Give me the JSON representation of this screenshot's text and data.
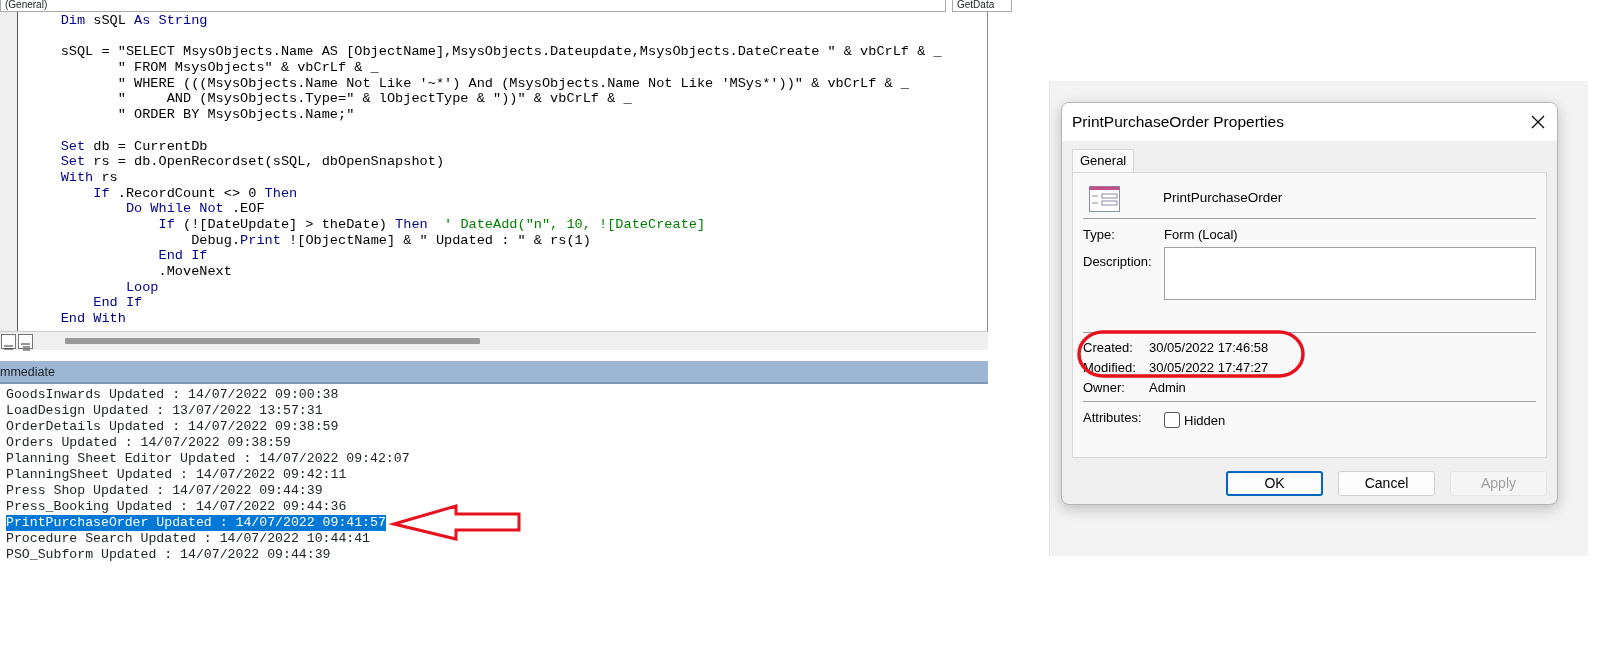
{
  "editor": {
    "object_combo": "(General)",
    "procedure_combo": "GetData",
    "code_lines": [
      {
        "kind": "code",
        "tokens": [
          {
            "kind": "keyword",
            "text": "    Dim"
          },
          {
            "kind": "plain",
            "text": " sSQL "
          },
          {
            "kind": "keyword",
            "text": "As String"
          }
        ]
      },
      {
        "kind": "blank"
      },
      {
        "kind": "code",
        "tokens": [
          {
            "kind": "plain",
            "text": "    sSQL = \"SELECT MsysObjects.Name AS [ObjectName],MsysObjects.Dateupdate,MsysObjects.DateCreate \" & vbCrLf & _"
          }
        ]
      },
      {
        "kind": "code",
        "tokens": [
          {
            "kind": "plain",
            "text": "           \" FROM MsysObjects\" & vbCrLf & _"
          }
        ]
      },
      {
        "kind": "code",
        "tokens": [
          {
            "kind": "plain",
            "text": "           \" WHERE (((MsysObjects.Name Not Like '~*') And (MsysObjects.Name Not Like 'MSys*'))\" & vbCrLf & _"
          }
        ]
      },
      {
        "kind": "code",
        "tokens": [
          {
            "kind": "plain",
            "text": "           \"     AND (MsysObjects.Type=\" & lObjectType & \"))\" & vbCrLf & _"
          }
        ]
      },
      {
        "kind": "code",
        "tokens": [
          {
            "kind": "plain",
            "text": "           \" ORDER BY MsysObjects.Name;\""
          }
        ]
      },
      {
        "kind": "blank"
      },
      {
        "kind": "code",
        "tokens": [
          {
            "kind": "keyword",
            "text": "    Set"
          },
          {
            "kind": "plain",
            "text": " db = CurrentDb"
          }
        ]
      },
      {
        "kind": "code",
        "tokens": [
          {
            "kind": "keyword",
            "text": "    Set"
          },
          {
            "kind": "plain",
            "text": " rs = db.OpenRecordset(sSQL, dbOpenSnapshot)"
          }
        ]
      },
      {
        "kind": "code",
        "tokens": [
          {
            "kind": "keyword",
            "text": "    With"
          },
          {
            "kind": "plain",
            "text": " rs"
          }
        ]
      },
      {
        "kind": "code",
        "tokens": [
          {
            "kind": "keyword",
            "text": "        If"
          },
          {
            "kind": "plain",
            "text": " .RecordCount <> 0 "
          },
          {
            "kind": "keyword",
            "text": "Then"
          }
        ]
      },
      {
        "kind": "code",
        "tokens": [
          {
            "kind": "keyword",
            "text": "            Do While Not"
          },
          {
            "kind": "plain",
            "text": " .EOF"
          }
        ]
      },
      {
        "kind": "code",
        "tokens": [
          {
            "kind": "keyword",
            "text": "                If"
          },
          {
            "kind": "plain",
            "text": " (![DateUpdate] > theDate) "
          },
          {
            "kind": "keyword",
            "text": "Then"
          },
          {
            "kind": "comment",
            "text": "  ' DateAdd(\"n\", 10, ![DateCreate]"
          }
        ]
      },
      {
        "kind": "code",
        "tokens": [
          {
            "kind": "plain",
            "text": "                    Debug."
          },
          {
            "kind": "keyword",
            "text": "Print"
          },
          {
            "kind": "plain",
            "text": " ![ObjectName] & \" Updated : \" & rs(1)"
          }
        ]
      },
      {
        "kind": "code",
        "tokens": [
          {
            "kind": "keyword",
            "text": "                End If"
          }
        ]
      },
      {
        "kind": "code",
        "tokens": [
          {
            "kind": "plain",
            "text": "                .MoveNext"
          }
        ]
      },
      {
        "kind": "code",
        "tokens": [
          {
            "kind": "keyword",
            "text": "            Loop"
          }
        ]
      },
      {
        "kind": "code",
        "tokens": [
          {
            "kind": "keyword",
            "text": "        End If"
          }
        ]
      },
      {
        "kind": "code",
        "tokens": [
          {
            "kind": "keyword",
            "text": "    End With"
          }
        ]
      }
    ]
  },
  "immediate": {
    "title": "mmediate",
    "lines": [
      {
        "text": "GoodsInwards Updated : 14/07/2022 09:00:38",
        "selected": false,
        "arrow": false
      },
      {
        "text": "LoadDesign Updated : 13/07/2022 13:57:31",
        "selected": false,
        "arrow": false
      },
      {
        "text": "OrderDetails Updated : 14/07/2022 09:38:59",
        "selected": false,
        "arrow": false
      },
      {
        "text": "Orders Updated : 14/07/2022 09:38:59",
        "selected": false,
        "arrow": false
      },
      {
        "text": "Planning Sheet Editor Updated : 14/07/2022 09:42:07",
        "selected": false,
        "arrow": false
      },
      {
        "text": "PlanningSheet Updated : 14/07/2022 09:42:11",
        "selected": false,
        "arrow": false
      },
      {
        "text": "Press Shop Updated : 14/07/2022 09:44:39",
        "selected": false,
        "arrow": false
      },
      {
        "text": "Press_Booking Updated : 14/07/2022 09:44:36",
        "selected": false,
        "arrow": false
      },
      {
        "text": "PrintPurchaseOrder Updated : 14/07/2022 09:41:57",
        "selected": true,
        "arrow": true
      },
      {
        "text": "Procedure Search Updated : 14/07/2022 10:44:41",
        "selected": false,
        "arrow": false
      },
      {
        "text": "PSO_Subform Updated : 14/07/2022 09:44:39",
        "selected": false,
        "arrow": false
      }
    ]
  },
  "dialog": {
    "title": "PrintPurchaseOrder Properties",
    "tabs": [
      {
        "label": "General",
        "selected": true
      }
    ],
    "object_name": "PrintPurchaseOrder",
    "type": {
      "label": "Type:",
      "value": "Form (Local)"
    },
    "description": {
      "label": "Description:"
    },
    "dates": [
      {
        "label": "Created:",
        "value": "30/05/2022 17:46:58",
        "circled": true
      },
      {
        "label": "Modified:",
        "value": "30/05/2022 17:47:27",
        "circled": true
      },
      {
        "label": "Owner:",
        "value": "Admin",
        "circled": false
      }
    ],
    "attributes": {
      "label": "Attributes:",
      "options": [
        {
          "label": "Hidden",
          "checked": false
        }
      ]
    },
    "buttons": [
      {
        "label": "OK",
        "default": true,
        "disabled": false
      },
      {
        "label": "Cancel",
        "default": false,
        "disabled": false
      },
      {
        "label": "Apply",
        "default": false,
        "disabled": true
      }
    ]
  }
}
